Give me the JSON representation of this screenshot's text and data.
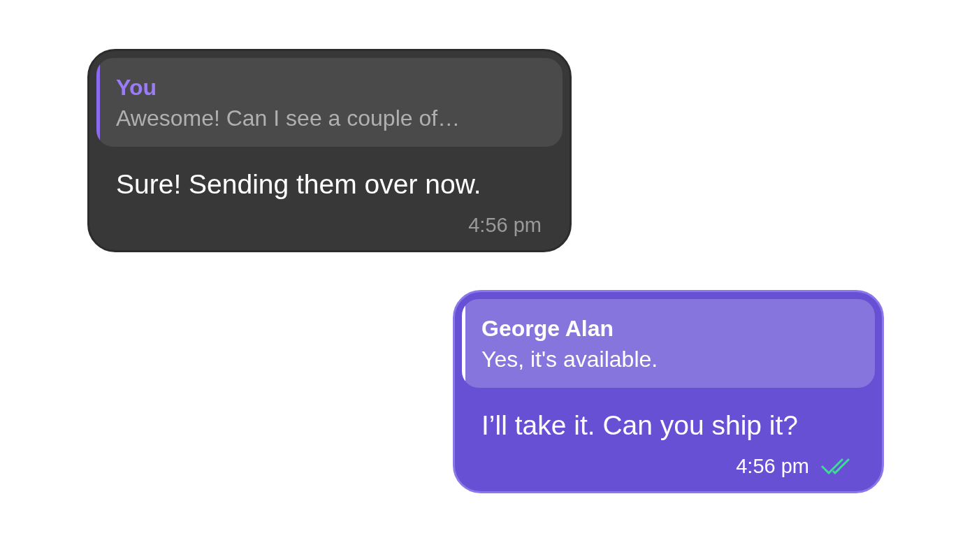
{
  "messages": [
    {
      "kind": "incoming",
      "reply": {
        "author": "You",
        "text": "Awesome! Can I see a couple of…"
      },
      "text": "Sure! Sending them over now.",
      "time": "4:56 pm"
    },
    {
      "kind": "outgoing",
      "reply": {
        "author": "George Alan",
        "text": "Yes, it's available."
      },
      "text": "I’ll take it. Can you ship it?",
      "time": "4:56 pm",
      "read": true
    }
  ]
}
